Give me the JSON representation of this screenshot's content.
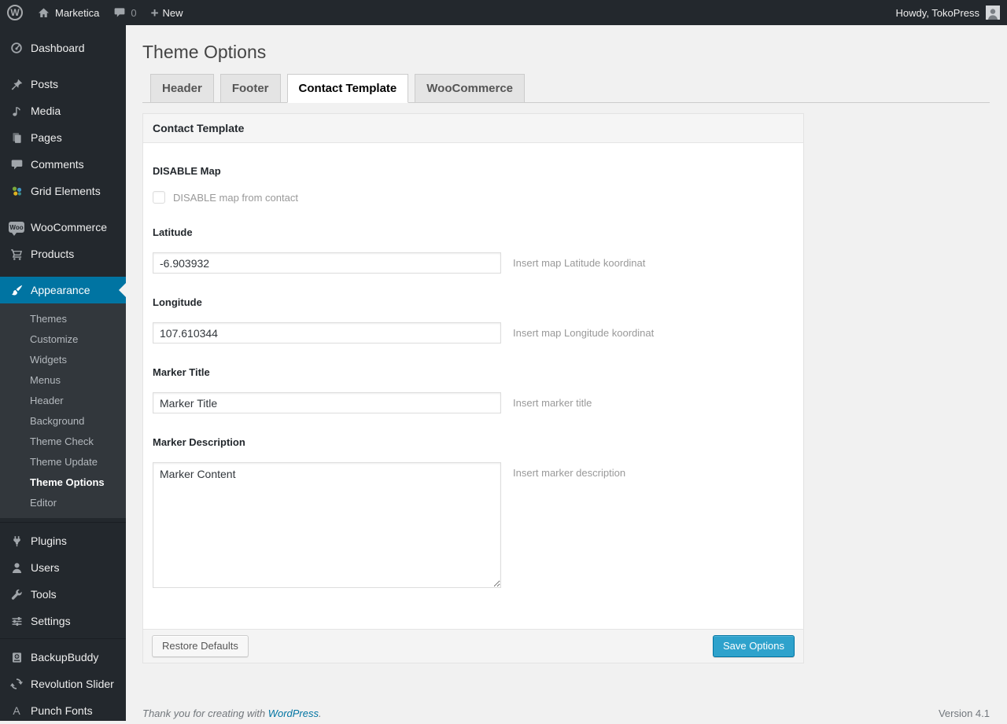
{
  "admin_bar": {
    "site_name": "Marketica",
    "comment_count": "0",
    "new_label": "New",
    "howdy": "Howdy, TokoPress"
  },
  "sidebar": {
    "items": [
      {
        "label": "Dashboard",
        "icon": "dashboard-gauge-icon"
      },
      {
        "label": "Posts",
        "icon": "pushpin-icon"
      },
      {
        "label": "Media",
        "icon": "music-note-icon"
      },
      {
        "label": "Pages",
        "icon": "pages-icon"
      },
      {
        "label": "Comments",
        "icon": "comment-bubble-icon"
      },
      {
        "label": "Grid Elements",
        "icon": "grid-elements-color-icon"
      },
      {
        "label": "WooCommerce",
        "icon": "woo-badge-icon"
      },
      {
        "label": "Products",
        "icon": "cart-icon"
      },
      {
        "label": "Appearance",
        "icon": "paintbrush-icon",
        "active": true
      },
      {
        "label": "Plugins",
        "icon": "plug-icon"
      },
      {
        "label": "Users",
        "icon": "user-icon"
      },
      {
        "label": "Tools",
        "icon": "wrench-icon"
      },
      {
        "label": "Settings",
        "icon": "sliders-icon"
      },
      {
        "label": "BackupBuddy",
        "icon": "backup-drive-icon"
      },
      {
        "label": "Revolution Slider",
        "icon": "refresh-arrows-icon"
      },
      {
        "label": "Punch Fonts",
        "icon": "letter-a-icon"
      }
    ],
    "appearance_submenu": [
      {
        "label": "Themes"
      },
      {
        "label": "Customize"
      },
      {
        "label": "Widgets"
      },
      {
        "label": "Menus"
      },
      {
        "label": "Header"
      },
      {
        "label": "Background"
      },
      {
        "label": "Theme Check"
      },
      {
        "label": "Theme Update"
      },
      {
        "label": "Theme Options",
        "current": true
      },
      {
        "label": "Editor"
      }
    ]
  },
  "main": {
    "page_title": "Theme Options",
    "tabs": [
      {
        "label": "Header"
      },
      {
        "label": "Footer"
      },
      {
        "label": "Contact Template",
        "active": true
      },
      {
        "label": "WooCommerce"
      }
    ],
    "panel_title": "Contact Template",
    "fields": {
      "disable_map": {
        "label": "DISABLE Map",
        "checkbox_label": "DISABLE map from contact",
        "checked": false
      },
      "latitude": {
        "label": "Latitude",
        "value": "-6.903932",
        "hint": "Insert map Latitude koordinat"
      },
      "longitude": {
        "label": "Longitude",
        "value": "107.610344",
        "hint": "Insert map Longitude koordinat"
      },
      "marker_title": {
        "label": "Marker Title",
        "value": "Marker Title",
        "hint": "Insert marker title"
      },
      "marker_description": {
        "label": "Marker Description",
        "value": "Marker Content",
        "hint": "Insert marker description"
      }
    },
    "buttons": {
      "restore": "Restore Defaults",
      "save": "Save Options"
    }
  },
  "footer": {
    "thanks_prefix": "Thank you for creating with",
    "wordpress_link": "WordPress",
    "thanks_suffix": ".",
    "version": "Version 4.1"
  },
  "colors": {
    "menu_highlight": "#0074a2",
    "primary_button": "#2ea2cc",
    "admin_bar_bg": "#23282d",
    "page_bg": "#f1f1f1",
    "icon_gray": "#a0a5aa"
  }
}
